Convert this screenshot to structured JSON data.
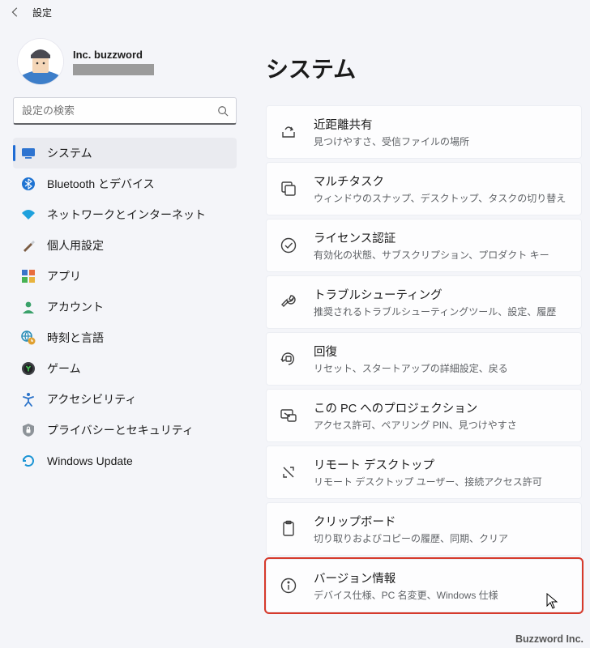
{
  "window": {
    "title": "設定"
  },
  "profile": {
    "name": "Inc. buzzword"
  },
  "search": {
    "placeholder": "設定の検索"
  },
  "sidebar": {
    "items": [
      {
        "label": "システム"
      },
      {
        "label": "Bluetooth とデバイス"
      },
      {
        "label": "ネットワークとインターネット"
      },
      {
        "label": "個人用設定"
      },
      {
        "label": "アプリ"
      },
      {
        "label": "アカウント"
      },
      {
        "label": "時刻と言語"
      },
      {
        "label": "ゲーム"
      },
      {
        "label": "アクセシビリティ"
      },
      {
        "label": "プライバシーとセキュリティ"
      },
      {
        "label": "Windows Update"
      }
    ]
  },
  "main": {
    "heading": "システム",
    "cards": [
      {
        "title": "近距離共有",
        "sub": "見つけやすさ、受信ファイルの場所"
      },
      {
        "title": "マルチタスク",
        "sub": "ウィンドウのスナップ、デスクトップ、タスクの切り替え"
      },
      {
        "title": "ライセンス認証",
        "sub": "有効化の状態、サブスクリプション、プロダクト キー"
      },
      {
        "title": "トラブルシューティング",
        "sub": "推奨されるトラブルシューティングツール、設定、履歴"
      },
      {
        "title": "回復",
        "sub": "リセット、スタートアップの詳細設定、戻る"
      },
      {
        "title": "この PC へのプロジェクション",
        "sub": "アクセス許可、ペアリング PIN、見つけやすさ"
      },
      {
        "title": "リモート デスクトップ",
        "sub": "リモート デスクトップ ユーザー、接続アクセス許可"
      },
      {
        "title": "クリップボード",
        "sub": "切り取りおよびコピーの履歴、同期、クリア"
      },
      {
        "title": "バージョン情報",
        "sub": "デバイス仕様、PC 名変更、Windows 仕様"
      }
    ]
  },
  "brand": "Buzzword Inc."
}
